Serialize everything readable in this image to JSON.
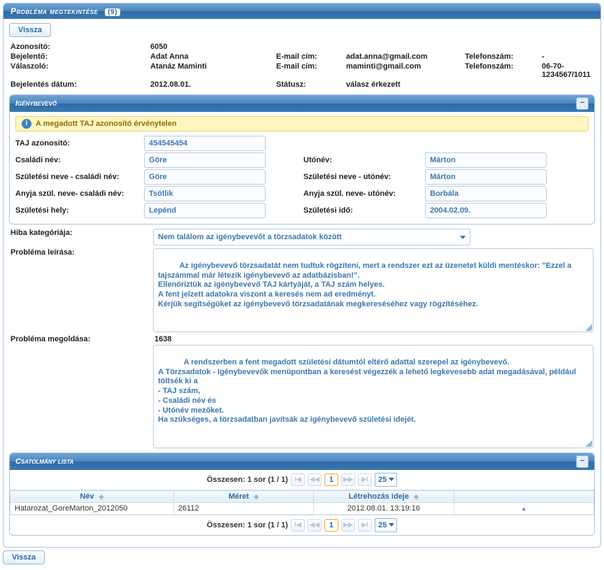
{
  "header": {
    "title": "Probléma megtekintése",
    "badge": "(9)"
  },
  "buttons": {
    "back": "Vissza"
  },
  "info": {
    "id_label": "Azonosító:",
    "id_value": "6050",
    "reporter_label": "Bejelentő:",
    "reporter_value": "Adat Anna",
    "reporter_email_label": "E-mail cím:",
    "reporter_email_value": "adat.anna@gmail.com",
    "reporter_phone_label": "Telefonszám:",
    "reporter_phone_value": "-",
    "responder_label": "Válaszoló:",
    "responder_value": "Atanáz Maminti",
    "responder_email_label": "E-mail cím:",
    "responder_email_value": "maminti@gmail.com",
    "responder_phone_label": "Telefonszám:",
    "responder_phone_value": "06-70-1234567/1011",
    "report_date_label": "Bejelentés dátum:",
    "report_date_value": "2012.08.01.",
    "status_label": "Státusz:",
    "status_value": "válasz érkezett"
  },
  "beneficiary": {
    "panel_title": "Igénybevevő",
    "warning": "A megadott TAJ azonosító érvénytelen",
    "taj_label": "TAJ azonosító:",
    "taj_value": "454545454",
    "family_label": "Családi név:",
    "family_value": "Göre",
    "given_label": "Utónév:",
    "given_value": "Márton",
    "birthfamily_label": "Születési neve - családi név:",
    "birthfamily_value": "Göre",
    "birthgiven_label": "Születési neve - utónév:",
    "birthgiven_value": "Márton",
    "motherfamily_label": "Anyja szül. neve- családi név:",
    "motherfamily_value": "Tsötlik",
    "mothergiven_label": "Anyja szül. neve- utónév:",
    "mothergiven_value": "Borbála",
    "birthplace_label": "Születési hely:",
    "birthplace_value": "Lepénd",
    "birthdate_label": "Születési idő:",
    "birthdate_value": "2004.02.09."
  },
  "problem": {
    "category_label": "Hiba kategóriája:",
    "category_value": "Nem találom az igénybevevőt a törzsadatok között",
    "description_label": "Probléma leírása:",
    "description_value": "Az igénybevevő törzsadatát nem tudtuk rögzíteni, mert a rendszer ezt az üzenetet küldi mentéskor: \"Ezzel a tajszámmal már létezik igénybevevő az adatbázisban!\".\nEllenőriztük az igénybevevő TAJ kártyáját, a TAJ szám helyes.\nA fent jelzett adatokra viszont a keresés nem ad eredményt.\nKérjük segítségüket az igénybevevő törzsadatának megkereséséhez vagy rögzítéséhez.",
    "solution_label": "Probléma megoldása:",
    "solution_id": "1638",
    "solution_value": "A rendszerben a fent megadott születési dátumtól eltérő adattal szerepel az igénybevevő.\nA Törzsadatok - Igénybevevők menüpontban a keresést végezzék a lehető legkevesebb adat megadásával, például töltsék ki a\n- TAJ szám,\n- Családi név és\n- Utónév mezőket.\nHa szükséges, a törzsadatban javítsák az igénybevevő születési idejét."
  },
  "attachments": {
    "panel_title": "Csatolmány lista",
    "summary": "Összesen: 1 sor (1 / 1)",
    "page_size": "25",
    "page_number": "1",
    "columns": {
      "name": "Név",
      "size": "Méret",
      "created": "Létrehozás ideje"
    },
    "rows": [
      {
        "name": "Hatarozat_GoreMarton_2012050",
        "size": "26112",
        "created": "2012.08.01. 13:19:16"
      }
    ]
  }
}
